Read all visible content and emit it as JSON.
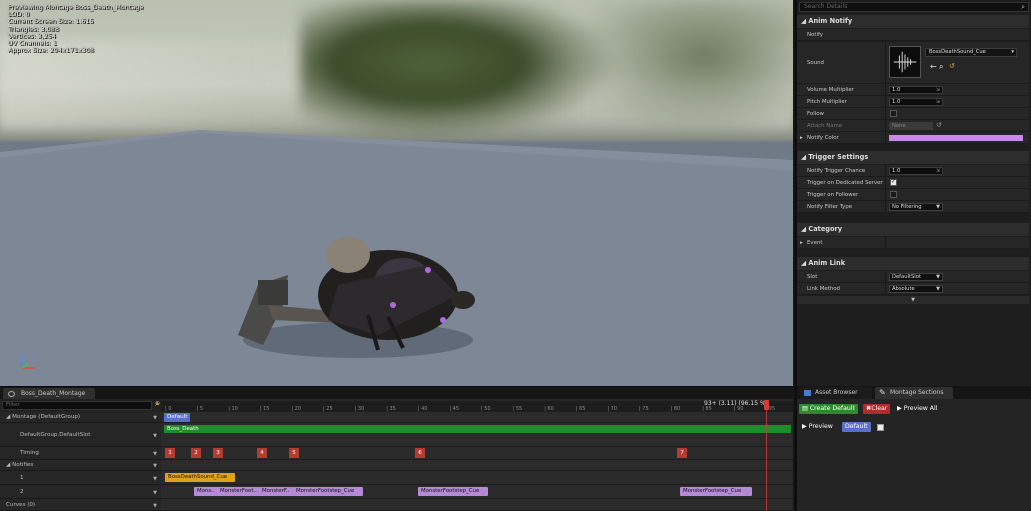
{
  "viewport": {
    "stats": [
      "Previewing Montage Boss_Death_Montage",
      "LOD: 0",
      "Current Screen Size: 1.615",
      "Triangles: 3,088",
      "Vertices: 3,254",
      "UV Channels: 1",
      "Approx Size: 294x171x308"
    ]
  },
  "details": {
    "search_placeholder": "Search Details",
    "anim_notify": {
      "header": "Anim Notify",
      "notify_label": "Notify",
      "sound_label": "Sound",
      "sound_value": "BossDeathSound_Cue",
      "volume_label": "Volume Multiplier",
      "volume_value": "1.0",
      "pitch_label": "Pitch Multiplier",
      "pitch_value": "1.0",
      "follow_label": "Follow",
      "attach_label": "Attach Name",
      "attach_value": "None",
      "notify_color_label": "Notify Color",
      "notify_color": "#c98be6"
    },
    "trigger_settings": {
      "header": "Trigger Settings",
      "chance_label": "Notify Trigger Chance",
      "chance_value": "1.0",
      "dedicated_label": "Trigger on Dedicated Server",
      "follower_label": "Trigger on Follower",
      "filter_label": "Notify Filter Type",
      "filter_value": "No Filtering"
    },
    "category": {
      "header": "Category",
      "event_label": "Event"
    },
    "anim_link": {
      "header": "Anim Link",
      "slot_label": "Slot",
      "slot_value": "DefaultSlot",
      "method_label": "Link Method",
      "method_value": "Absolute"
    }
  },
  "timeline": {
    "tab_label": "Boss_Death_Montage",
    "filter_placeholder": "Filter",
    "rows": {
      "montage": "Montage (DefaultGroup)",
      "slot": "DefaultGroup.DefaultSlot",
      "timing": "Timing",
      "notifies": "Notifies",
      "track1": "1",
      "track2": "2",
      "curves": "Curves (0)"
    },
    "frame_readout": "93+ (3.11) (96.15 %)",
    "ruler_ticks": [
      "0",
      "5",
      "10",
      "15",
      "20",
      "25",
      "30",
      "35",
      "40",
      "45",
      "50",
      "55",
      "60",
      "65",
      "70",
      "75",
      "80",
      "85",
      "90",
      "95"
    ],
    "section_label": "Default",
    "segment_label": "Boss_Death",
    "timing_markers": [
      "1",
      "2",
      "3",
      "4",
      "5",
      "6",
      "7"
    ],
    "notify_track1": "BossDeathSound_Cue",
    "notify_track2": [
      "Mons..",
      "MonsterFoot..",
      "MonsterF..",
      "MonsterFootstep_Cue",
      "MonsterFootstep_Cue",
      "MonsterFootstep_Cue"
    ]
  },
  "right_bottom": {
    "tabs": [
      "Asset Browser",
      "Montage Sections"
    ],
    "create_default": "Create Default",
    "clear": "Clear",
    "preview_all": "Preview All",
    "preview": "Preview",
    "default_section": "Default"
  },
  "colors": {
    "segment_green": "#1f8c2b",
    "notify_orange": "#e0a21c",
    "notify_purple": "#b48ad6",
    "timing_red": "#b43a34",
    "section_blue": "#5a6fc9"
  }
}
